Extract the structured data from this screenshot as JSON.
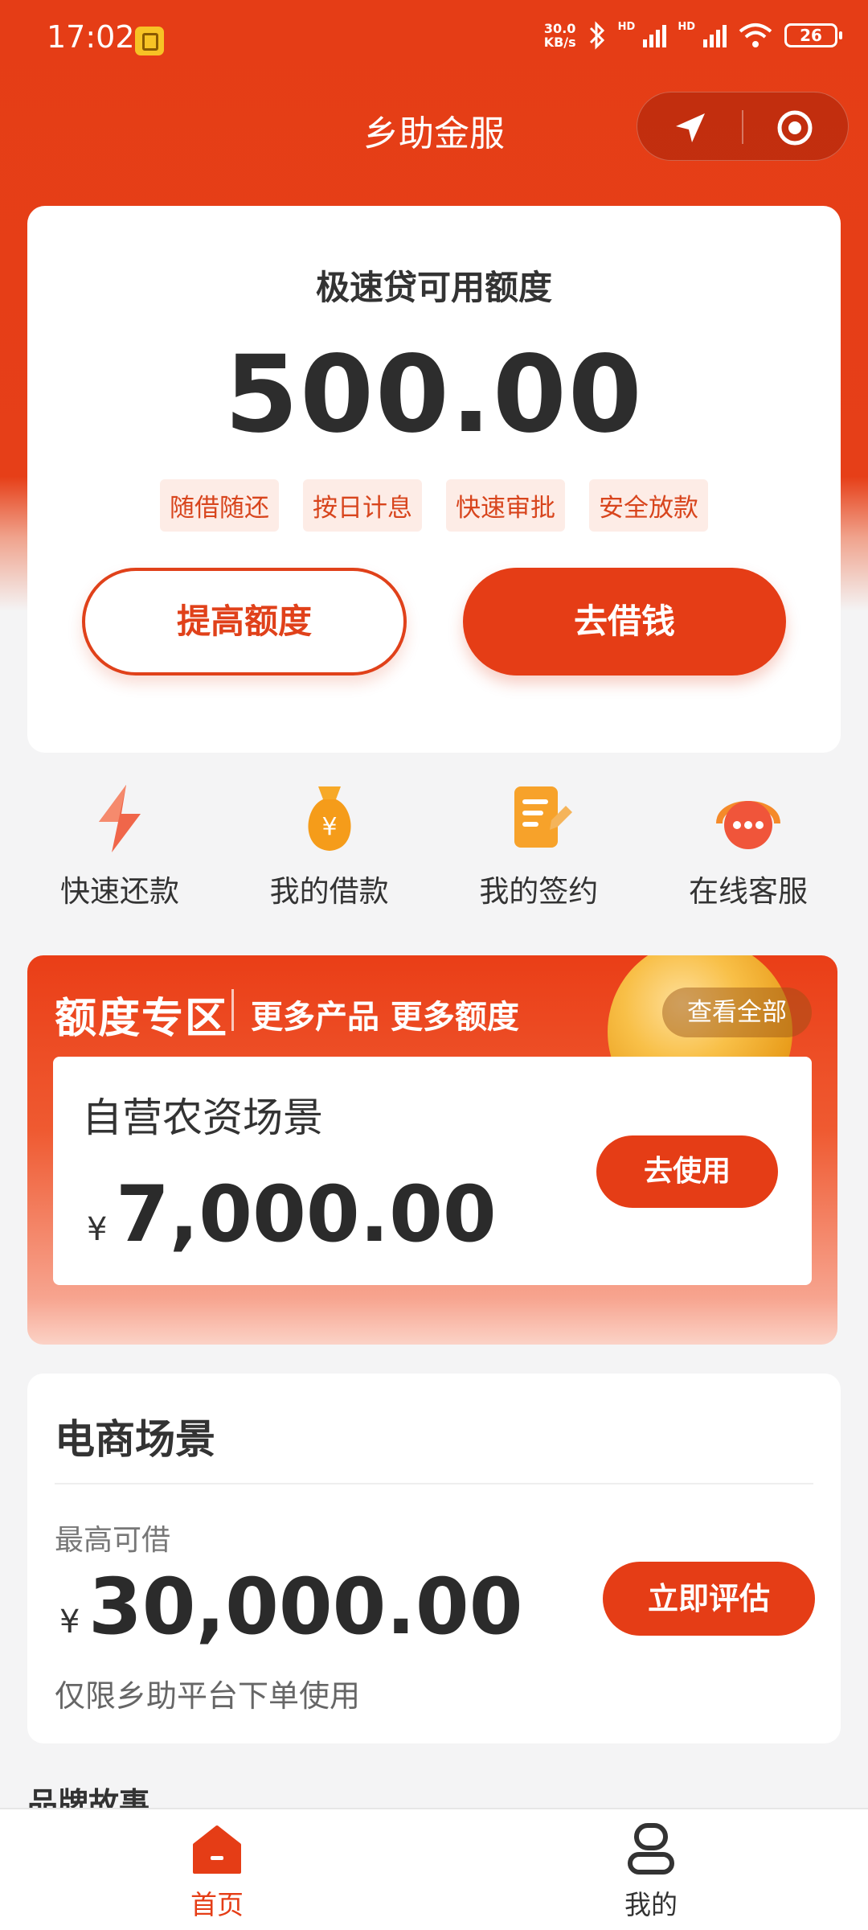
{
  "status": {
    "time": "17:02",
    "net_speed_top": "30.0",
    "net_speed_bottom": "KB/s",
    "hd1": "HD",
    "hd2": "HD",
    "battery": "26"
  },
  "header": {
    "title": "乡助金服"
  },
  "credit": {
    "label": "极速贷可用额度",
    "amount": "500.00",
    "tags": [
      "随借随还",
      "按日计息",
      "快速审批",
      "安全放款"
    ],
    "raise_label": "提高额度",
    "borrow_label": "去借钱"
  },
  "quick_actions": [
    {
      "label": "快速还款",
      "icon": "lightning-icon"
    },
    {
      "label": "我的借款",
      "icon": "money-bag-icon"
    },
    {
      "label": "我的签约",
      "icon": "document-icon"
    },
    {
      "label": "在线客服",
      "icon": "headset-icon"
    }
  ],
  "zone": {
    "title": "额度专区",
    "subtitle": "更多产品 更多额度",
    "view_all": "查看全部",
    "scene": "自营农资场景",
    "currency": "¥",
    "amount": "7,000.00",
    "use_label": "去使用"
  },
  "ecommerce": {
    "title": "电商场景",
    "max_label": "最高可借",
    "currency": "¥",
    "amount": "30,000.00",
    "note": "仅限乡助平台下单使用",
    "evaluate_label": "立即评估"
  },
  "brand_story": "品牌故事",
  "nav": {
    "home_label": "首页",
    "me_label": "我的"
  },
  "colors": {
    "primary": "#e53d16",
    "tag_bg": "#fdece6",
    "page_bg": "#f4f4f5"
  }
}
